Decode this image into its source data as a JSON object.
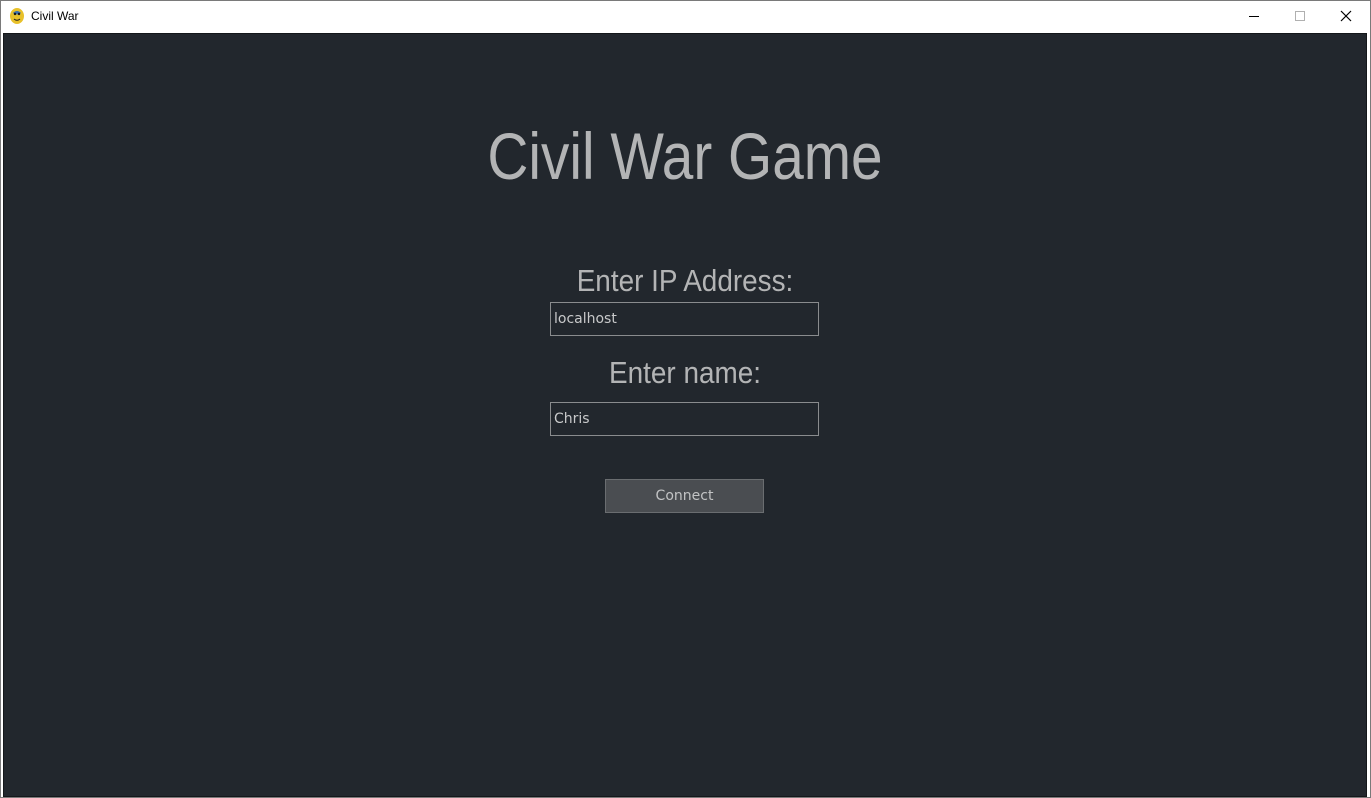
{
  "window": {
    "title": "Civil War",
    "icon": "python-snake-icon",
    "controls": [
      "minimize-icon",
      "maximize-icon",
      "close-icon"
    ]
  },
  "screen": {
    "heading": "Civil War Game",
    "ip_label": "Enter IP Address:",
    "ip_value": "localhost",
    "name_label": "Enter name:",
    "name_value": "Chris",
    "connect_label": "Connect"
  },
  "colors": {
    "background": "#22272d",
    "text": "#b3b4b5",
    "button": "#4a4d51",
    "field_border": "#8a8c8e"
  }
}
